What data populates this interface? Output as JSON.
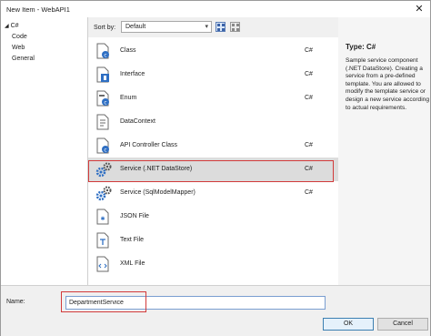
{
  "window": {
    "title": "New Item - WebAPI1",
    "close_glyph": "✕"
  },
  "tree": {
    "items": [
      {
        "label": "C#",
        "expanded": true
      },
      {
        "label": "Code"
      },
      {
        "label": "Web"
      },
      {
        "label": "General"
      }
    ]
  },
  "sortbar": {
    "label": "Sort by:",
    "selected": "Default"
  },
  "templates": [
    {
      "label": "Class",
      "lang": "C#",
      "icon": "class-icon"
    },
    {
      "label": "Interface",
      "lang": "C#",
      "icon": "interface-icon"
    },
    {
      "label": "Enum",
      "lang": "C#",
      "icon": "enum-icon"
    },
    {
      "label": "DataContext",
      "lang": "",
      "icon": "datacontext-icon"
    },
    {
      "label": "API Controller Class",
      "lang": "C#",
      "icon": "api-controller-icon"
    },
    {
      "label": "Service (.NET DataStore)",
      "lang": "C#",
      "icon": "service-gear-icon",
      "selected": true
    },
    {
      "label": "Service (SqlModelMapper)",
      "lang": "C#",
      "icon": "service-gear-icon"
    },
    {
      "label": "JSON File",
      "lang": "",
      "icon": "json-file-icon"
    },
    {
      "label": "Text File",
      "lang": "",
      "icon": "text-file-icon"
    },
    {
      "label": "XML File",
      "lang": "",
      "icon": "xml-file-icon"
    }
  ],
  "details": {
    "type": "Type:  C#",
    "description": "Sample service component (.NET DataStore). Creating a service from a pre-defined template. You are allowed to modify the template service or design a new service according to actual requirements."
  },
  "name_field": {
    "label": "Name:",
    "value": "DepartmentService"
  },
  "buttons": {
    "ok": "OK",
    "cancel": "Cancel"
  },
  "colors": {
    "highlight": "#d23a3a",
    "accent": "#2f6fc3",
    "selection": "#dcdcdc"
  }
}
